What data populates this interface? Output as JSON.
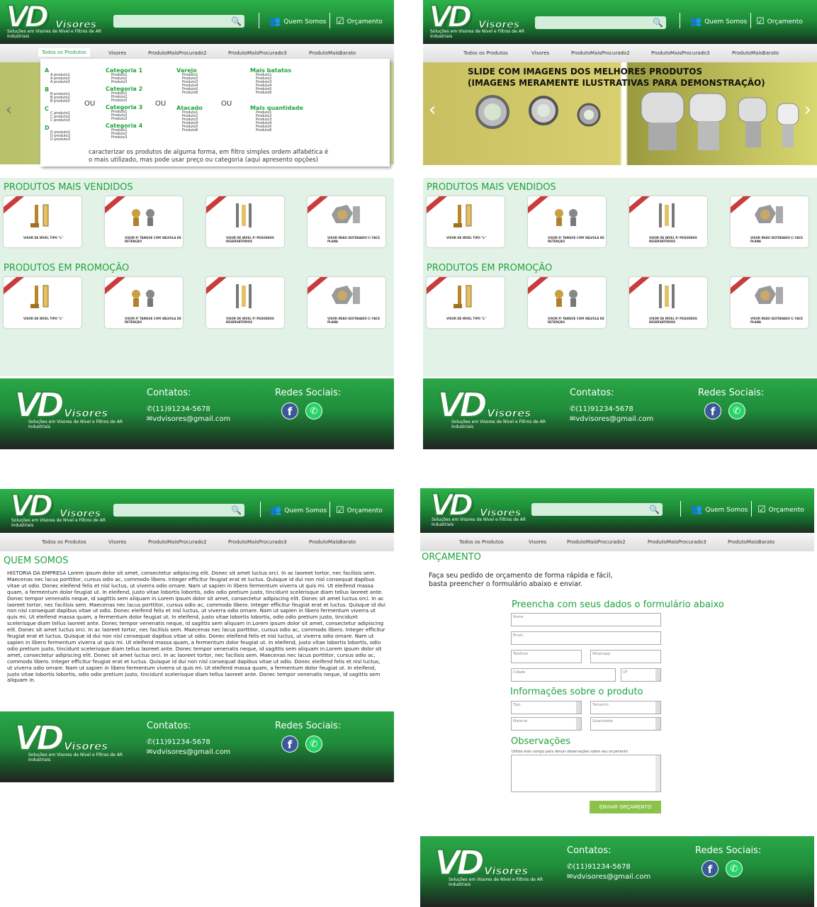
{
  "brand": {
    "logo": "VD",
    "name": "Visores",
    "tagline": "Soluções em Visores de Nível e Filtros de AR Industriais"
  },
  "header": {
    "search_placeholder": "",
    "quem_somos": "Quem Somos",
    "orcamento": "Orçamento"
  },
  "nav": [
    "Todos os Produtos",
    "Visores",
    "ProdutoMaisProcurado2",
    "ProdutoMaisProcurado3",
    "ProdutoMaisBarato"
  ],
  "mega": {
    "letters": [
      {
        "l": "A",
        "items": [
          "A produto1",
          "A produto2",
          "A produto3"
        ]
      },
      {
        "l": "B",
        "items": [
          "B produto1",
          "B produto2",
          "B produto3"
        ]
      },
      {
        "l": "C",
        "items": [
          "C produto1",
          "C produto2",
          "C produto3"
        ]
      },
      {
        "l": "D",
        "items": [
          "D produto1",
          "D produto2",
          "D produto3"
        ]
      }
    ],
    "ou": "OU",
    "categorias": [
      {
        "t": "Categoria 1",
        "items": [
          "Produto1",
          "Produto2",
          "Produto3"
        ]
      },
      {
        "t": "Categoria 2",
        "items": [
          "Produto1",
          "Produto2",
          "Produto3"
        ]
      },
      {
        "t": "Categoria 3",
        "items": [
          "Produto1",
          "Produto2",
          "Produto3"
        ]
      },
      {
        "t": "Categoria 4",
        "items": [
          "Produto1",
          "Produto2",
          "Produto3"
        ]
      }
    ],
    "varejo": {
      "t": "Varejo",
      "items": [
        "Produto1",
        "Produto2",
        "Produto3",
        "Produto4",
        "Produto5",
        "Produto6"
      ]
    },
    "atacado": {
      "t": "Atacado",
      "items": [
        "Produto1",
        "Produto2",
        "Produto3",
        "Produto4",
        "Produto5",
        "Produto6"
      ]
    },
    "baratos": {
      "t": "Mais batatos",
      "items": [
        "Produto1",
        "Produto2",
        "Produto3",
        "Produto4",
        "Produto5",
        "Produto6"
      ]
    },
    "quantidade": {
      "t": "Mais quantidade",
      "items": [
        "Produto1",
        "Produto2",
        "Produto3",
        "Produto4",
        "Produto5",
        "Produto6"
      ]
    },
    "note1": "caracterizar os produtos de alguma forma, em filtro simples ordem alfabética é",
    "note2": "o mais utilizado, mas pode usar preço ou categoria (aqui apresento opções)"
  },
  "slide": {
    "line1": "SLIDE COM IMAGENS DOS MELHORES PRODUTOS",
    "line2": "(IMAGENS MERAMENTE ILUSTRATIVAS PARA DEMONSTRAÇÃO)"
  },
  "sections": {
    "vendidos": "PRODUTOS MAIS VENDIDOS",
    "promocao": "PRODUTOS EM PROMOÇÃO"
  },
  "products": [
    "VISOR DE NÍVEL TIPO \"L\"",
    "VISOR P/ TANQUE COM VÁLVULA DE RETENÇÃO",
    "VISOR DE NÍVEL P/ PEQUENOS RESERVATÓRIOS",
    "VISOR IRIÃO SEXTAVADO C/ FACE PLANA"
  ],
  "about": {
    "title": "QUEM SOMOS",
    "text": "HISTORIA DA EMPRESA Lorem ipsum dolor sit amet, consectetur adipiscing elit. Donec sit amet luctus orci. In ac laoreet tortor, nec facilisis sem. Maecenas nec lacus porttitor, cursus odio ac, commodo libero. Integer efficitur feugiat erat et luctus. Quisque id dui non nisl consequat dapibus vitae ut odio. Donec eleifend felis et nisl luctus, ut viverra odio ornare. Nam ut sapien in libero fermentum viverra ut quis mi. Ut eleifend massa quam, a fermentum dolor feugiat ut. In eleifend, justo vitae lobortis lobortis, odio odio pretium justo, tincidunt scelerisque diam tellus laoreet ante. Donec tempor venenatis neque, id sagittis sem aliquam in.Lorem ipsum dolor sit amet, consectetur adipiscing elit. Donec sit amet luctus orci. In ac laoreet tortor, nec facilisis sem. Maecenas nec lacus porttitor, cursus odio ac, commodo libero. Integer efficitur feugiat erat et luctus. Quisque id dui non nisl consequat dapibus vitae ut odio. Donec eleifend felis et nisl luctus, ut viverra odio ornare. Nam ut sapien in libero fermentum viverra ut quis mi. Ut eleifend massa quam, a fermentum dolor feugiat ut. In eleifend, justo vitae lobortis lobortis, odio odio pretium justo, tincidunt scelerisque diam tellus laoreet ante. Donec tempor venenatis neque, id sagittis sem aliquam in.Lorem ipsum dolor sit amet, consectetur adipiscing elit. Donec sit amet luctus orci. In ac laoreet tortor, nec facilisis sem. Maecenas nec lacus porttitor, cursus odio ac, commodo libero. Integer efficitur feugiat erat et luctus. Quisque id dui non nisl consequat dapibus vitae ut odio. Donec eleifend felis et nisl luctus, ut viverra odio ornare. Nam ut sapien in libero fermentum viverra ut quis mi. Ut eleifend massa quam, a fermentum dolor feugiat ut. In eleifend, justo vitae lobortis lobortis, odio odio pretium justo, tincidunt scelerisque diam tellus laoreet ante. Donec tempor venenatis neque, id sagittis sem aliquam in.Lorem ipsum dolor sit amet, consectetur adipiscing elit. Donec sit amet luctus orci. In ac laoreet tortor, nec facilisis sem. Maecenas nec lacus porttitor, cursus odio ac, commodo libero. Integer efficitur feugiat erat et luctus. Quisque id dui non nisl consequat dapibus vitae ut odio. Donec eleifend felis et nisl luctus, ut viverra odio ornare. Nam ut sapien in libero fermentum viverra ut quis mi. Ut eleifend massa quam, a fermentum dolor feugiat ut. In eleifend, justo vitae lobortis lobortis, odio odio pretium justo, tincidunt scelerisque diam tellus laoreet ante. Donec tempor venenatis neque, id sagittis sem aliquam in."
  },
  "quote": {
    "title": "ORÇAMENTO",
    "intro1": "Faça seu pedido de orçamento de forma rápida e fácil,",
    "intro2": "basta preencher o formulário abaixo e enviar.",
    "form_title": "Preencha com seus dados o formulário abaixo",
    "nome": "Nome",
    "email": "Email",
    "telefone": "Telefone",
    "whatsapp": "Whatsapp",
    "cidade": "Cidade",
    "uf": "UF",
    "prod_title": "Informações sobre o produto",
    "tipo": "Tipo",
    "tamanho": "Tamanho",
    "material": "Material",
    "quantidade": "Quantidade",
    "obs_title": "Observações",
    "obs_hint": "Utilize este campo para deixar observações sobre seu orçamento",
    "submit": "ENVIAR ORÇAMENTO"
  },
  "footer": {
    "contatos": "Contatos:",
    "phone": "(11)91234-5678",
    "email": "vdvisores@gmail.com",
    "redes": "Redes Sociais:"
  }
}
